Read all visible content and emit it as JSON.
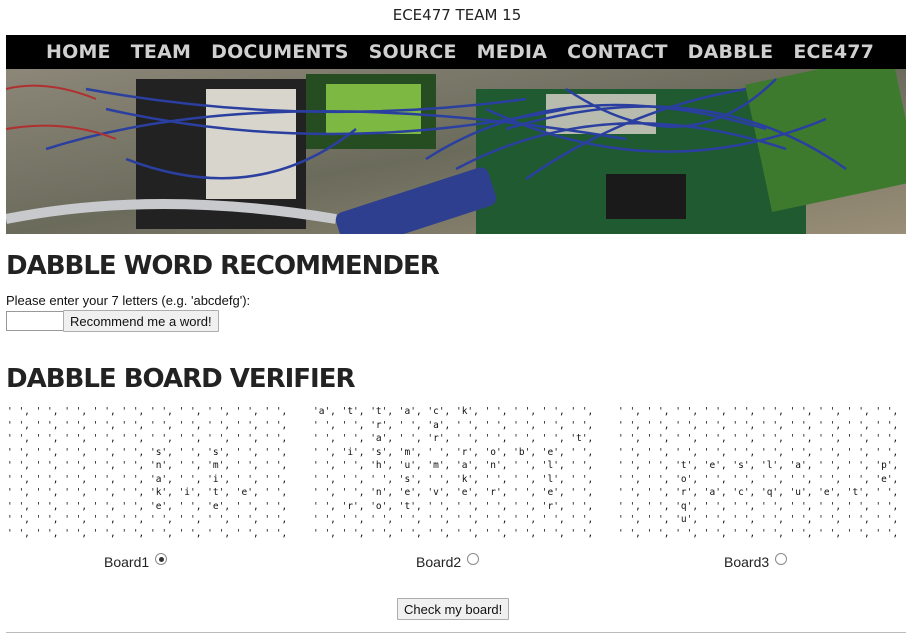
{
  "site": {
    "title": "ECE477 TEAM 15"
  },
  "nav": [
    "HOME",
    "TEAM",
    "DOCUMENTS",
    "SOURCE",
    "MEDIA",
    "CONTACT",
    "DABBLE",
    "ECE477"
  ],
  "recommender": {
    "heading": "DABBLE WORD RECOMMENDER",
    "prompt": "Please enter your 7 letters (e.g. 'abcdefg'):",
    "input_value": "",
    "button": "Recommend me a word!"
  },
  "verifier": {
    "heading": "DABBLE BOARD VERIFIER",
    "boards": [
      {
        "label": "Board1",
        "selected": true,
        "rows": [
          "' ', ' ', ' ', ' ', ' ', ' ', ' ', ' ', ' ', ' ',",
          "' ', ' ', ' ', ' ', ' ', ' ', ' ', ' ', ' ', ' ',",
          "' ', ' ', ' ', ' ', ' ', ' ', ' ', ' ', ' ', ' ',",
          "' ', ' ', ' ', ' ', ' ', 's', ' ', 's', ' ', ' ',",
          "' ', ' ', ' ', ' ', ' ', 'n', ' ', 'm', ' ', ' ',",
          "' ', ' ', ' ', ' ', ' ', 'a', ' ', 'i', ' ', ' ',",
          "' ', ' ', ' ', ' ', ' ', 'k', 'i', 't', 'e', ' ',",
          "' ', ' ', ' ', ' ', ' ', 'e', ' ', 'e', ' ', ' ',",
          "' ', ' ', ' ', ' ', ' ', ' ', ' ', ' ', ' ', ' ',",
          "' ', ' ', ' ', ' ', ' ', ' ', ' ', ' ', ' ', ' ',"
        ]
      },
      {
        "label": "Board2",
        "selected": false,
        "rows": [
          "'a', 't', 't', 'a', 'c', 'k', ' ', ' ', ' ', ' ',",
          "' ', ' ', 'r', ' ', 'a', ' ', ' ', ' ', ' ', ' ',",
          "' ', ' ', 'a', ' ', 'r', ' ', ' ', ' ', ' ', 't',",
          "' ', 'i', 's', 'm', ' ', 'r', 'o', 'b', 'e', ' ',",
          "' ', ' ', 'h', 'u', 'm', 'a', 'n', ' ', 'l', ' ',",
          "' ', ' ', ' ', 's', ' ', 'k', ' ', ' ', 'l', ' ',",
          "' ', ' ', 'n', 'e', 'v', 'e', 'r', ' ', 'e', ' ',",
          "' ', 'r', 'o', 't', ' ', ' ', ' ', ' ', 'r', ' ',",
          "' ', ' ', ' ', ' ', ' ', ' ', ' ', ' ', ' ', ' ',",
          "' ', ' ', ' ', ' ', ' ', ' ', ' ', ' ', ' ', ' ',"
        ]
      },
      {
        "label": "Board3",
        "selected": false,
        "rows": [
          "' ', ' ', ' ', ' ', ' ', ' ', ' ', ' ', ' ', ' ',",
          "' ', ' ', ' ', ' ', ' ', ' ', ' ', ' ', ' ', ' ',",
          "' ', ' ', ' ', ' ', ' ', ' ', ' ', ' ', ' ', ' ',",
          "' ', ' ', ' ', ' ', ' ', ' ', ' ', ' ', ' ', ' ',",
          "' ', ' ', 't', 'e', 's', 'l', 'a', ' ', ' ', 'p',",
          "' ', ' ', 'o', ' ', ' ', ' ', ' ', ' ', ' ', 'e',",
          "' ', ' ', 'r', 'a', 'c', 'q', 'u', 'e', 't', ' ',",
          "' ', ' ', 'q', ' ', ' ', ' ', ' ', ' ', ' ', ' ',",
          "' ', ' ', 'u', ' ', ' ', ' ', ' ', ' ', ' ', ' ',",
          "' ', ' ', ' ', ' ', ' ', ' ', ' ', ' ', ' ', ' ',"
        ]
      }
    ],
    "check_button": "Check my board!"
  }
}
